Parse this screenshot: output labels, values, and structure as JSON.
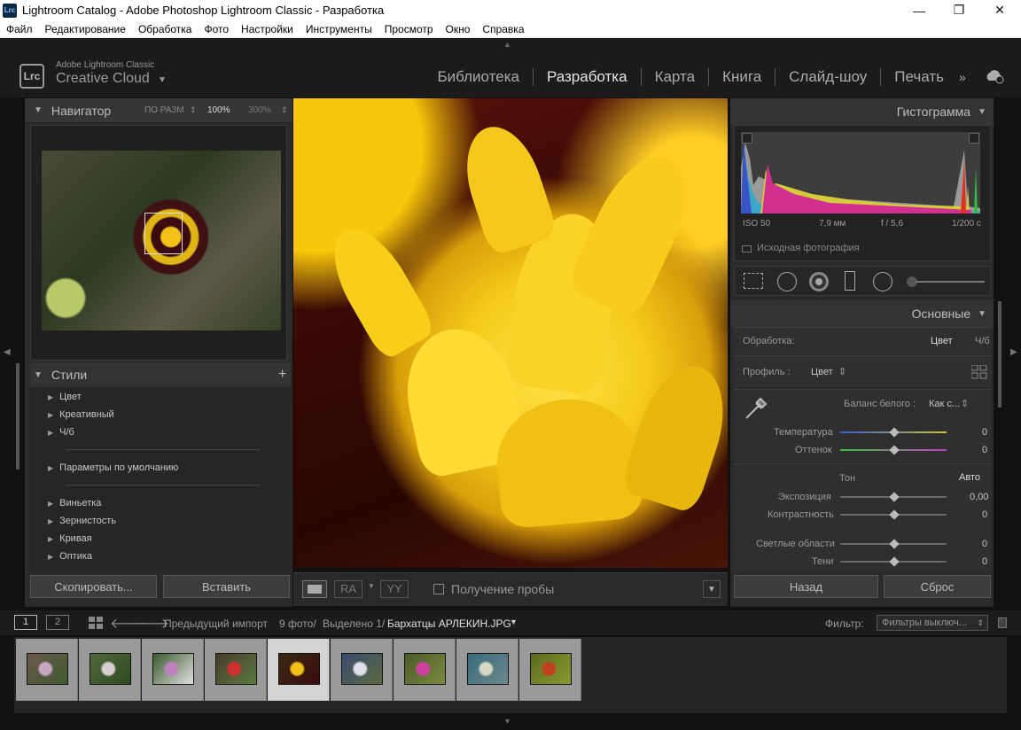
{
  "window": {
    "title": "Lightroom Catalog - Adobe Photoshop Lightroom Classic - Разработка",
    "app_icon": "Lrc"
  },
  "menu": [
    "Файл",
    "Редактирование",
    "Обработка",
    "Фото",
    "Настройки",
    "Инструменты",
    "Просмотр",
    "Окно",
    "Справка"
  ],
  "brand": {
    "logo": "Lrc",
    "line1": "Adobe Lightroom Classic",
    "line2": "Creative Cloud"
  },
  "modules": [
    {
      "label": "Библиотека",
      "active": false
    },
    {
      "label": "Разработка",
      "active": true
    },
    {
      "label": "Карта",
      "active": false
    },
    {
      "label": "Книга",
      "active": false
    },
    {
      "label": "Слайд-шоу",
      "active": false
    },
    {
      "label": "Печать",
      "active": false
    }
  ],
  "left": {
    "navigator": {
      "title": "Навигатор",
      "fit": "ПО РАЗМ",
      "zoom100": "100%",
      "zoom300": "300%"
    },
    "styles": {
      "title": "Стили",
      "groups": [
        "Цвет",
        "Креативный",
        "Ч/б",
        "Параметры по умолчанию",
        "Виньетка",
        "Зернистость",
        "Кривая",
        "Оптика"
      ]
    },
    "copy_button": "Скопировать...",
    "paste_button": "Вставить"
  },
  "toolbar": {
    "rgb_label": "RA",
    "yy_label": "YY",
    "sampling_label": "Получение пробы"
  },
  "right": {
    "histogram": {
      "title": "Гистограмма",
      "iso": "ISO 50",
      "focal": "7,9 мм",
      "aperture": "f / 5,6",
      "shutter": "1/200 с",
      "original_label": "Исходная фотография"
    },
    "basic": {
      "title": "Основные",
      "treatment_label": "Обработка:",
      "treatment_color": "Цвет",
      "treatment_bw": "Ч/б",
      "profile_label": "Профиль :",
      "profile_value": "Цвет",
      "wb_label": "Баланс белого :",
      "wb_value": "Как с...",
      "temp_label": "Температура",
      "temp_value": "0",
      "tint_label": "Оттенок",
      "tint_value": "0",
      "tone_label": "Тон",
      "auto_label": "Авто",
      "exposure_label": "Экспозиция",
      "exposure_value": "0,00",
      "contrast_label": "Контрастность",
      "contrast_value": "0",
      "highlights_label": "Светлые области",
      "highlights_value": "0",
      "shadows_label": "Тени",
      "shadows_value": "0"
    },
    "prev_button": "Назад",
    "reset_button": "Сброс"
  },
  "filmstrip_bar": {
    "page1": "1",
    "page2": "2",
    "source": "Предыдущий импорт",
    "count": "9 фото/",
    "selected": "Выделено 1/",
    "filename": "Бархатцы АРЛЕКИН.JPG",
    "filter_label": "Фильтр:",
    "filter_value": "Фильтры выключ..."
  },
  "filmstrip": {
    "selected_index": 4,
    "thumbs": [
      {
        "colors": [
          "#6b5a4a",
          "#c8a8c0",
          "#3e5a30"
        ]
      },
      {
        "colors": [
          "#4e6a3a",
          "#d8d0d0",
          "#2e4a22"
        ]
      },
      {
        "colors": [
          "#3a5a2a",
          "#c080c0",
          "#e0e0e0"
        ]
      },
      {
        "colors": [
          "#4a3a2a",
          "#d03030",
          "#5a7a40"
        ]
      },
      {
        "colors": [
          "#3a2a10",
          "#f2c21a",
          "#3b0b0f"
        ]
      },
      {
        "colors": [
          "#3a4a70",
          "#e0e0e8",
          "#5a6a40"
        ]
      },
      {
        "colors": [
          "#4a5a2a",
          "#d040a0",
          "#7a8a40"
        ]
      },
      {
        "colors": [
          "#3a6a7a",
          "#d8d8c0",
          "#6a8a90"
        ]
      },
      {
        "colors": [
          "#5a6a20",
          "#c04020",
          "#8a9a30"
        ]
      }
    ]
  }
}
